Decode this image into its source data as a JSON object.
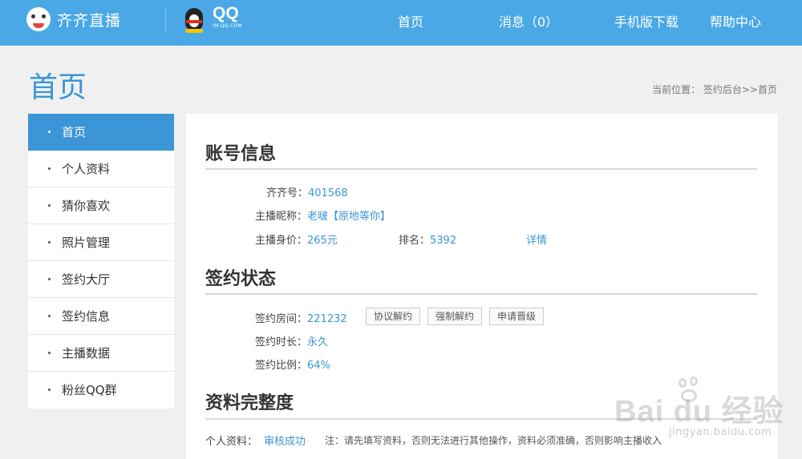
{
  "header": {
    "brand_name": "齐齐直播",
    "qq_big": "QQ",
    "qq_small": "IM.QQ.COM",
    "nav": [
      {
        "label": "首页"
      },
      {
        "label": "消息（0）"
      },
      {
        "label": "手机版下载"
      },
      {
        "label": "帮助中心"
      }
    ]
  },
  "page": {
    "title": "首页",
    "breadcrumb": "当前位置： 签约后台>>首页"
  },
  "sidebar": {
    "items": [
      {
        "label": "首页",
        "active": true
      },
      {
        "label": "个人资料"
      },
      {
        "label": "猜你喜欢"
      },
      {
        "label": "照片管理"
      },
      {
        "label": "签约大厅"
      },
      {
        "label": "签约信息"
      },
      {
        "label": "主播数据"
      },
      {
        "label": "粉丝QQ群"
      }
    ]
  },
  "account": {
    "title": "账号信息",
    "qiqi_label": "齐齐号：",
    "qiqi_value": "401568",
    "nick_label": "主播昵称：",
    "nick_value": "老啵【原地等你】",
    "worth_label": "主播身价：",
    "worth_value": "265元",
    "rank_label": "排名：",
    "rank_value": "5392",
    "detail_link": "详情"
  },
  "contract": {
    "title": "签约状态",
    "room_label": "签约房间：",
    "room_value": "221232",
    "buttons": [
      "协议解约",
      "强制解约",
      "申请晋级"
    ],
    "duration_label": "签约时长：",
    "duration_value": "永久",
    "ratio_label": "签约比例：",
    "ratio_value": "64%"
  },
  "profile": {
    "title": "资料完整度",
    "personal_label": "个人资料：",
    "personal_status": "审核成功",
    "note": "注：请先填写资料，否则无法进行其他操作，资料必须准确，否则影响主播收入"
  },
  "watermark": {
    "text": "Bai du 经验",
    "url": "jingyan.baidu.com"
  },
  "colors": {
    "header_bg": "#4aa8e6",
    "accent": "#3b95d6",
    "page_bg": "#f0f0f0"
  }
}
